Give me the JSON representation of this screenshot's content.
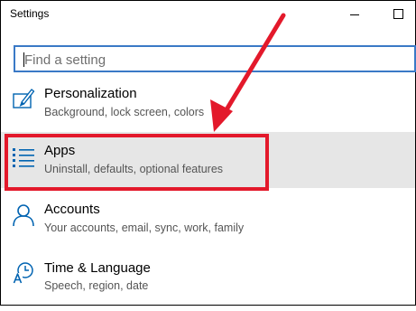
{
  "window": {
    "title": "Settings",
    "controls": {
      "minimize": "minimize",
      "maximize": "maximize"
    }
  },
  "search": {
    "placeholder": "Find a setting",
    "value": ""
  },
  "categories": [
    {
      "name": "Personalization",
      "description": "Background, lock screen, colors",
      "icon": "personalization-icon"
    },
    {
      "name": "Apps",
      "description": "Uninstall, defaults, optional features",
      "icon": "apps-icon",
      "selected": true
    },
    {
      "name": "Accounts",
      "description": "Your accounts, email, sync, work, family",
      "icon": "person-icon"
    },
    {
      "name": "Time & Language",
      "description": "Speech, region, date",
      "icon": "time-language-icon"
    }
  ],
  "annotation": {
    "color": "#e3192b",
    "highlight_target": "Apps",
    "arrow": "pointing at Apps"
  },
  "colors": {
    "accent": "#0063b1",
    "search_border": "#3a79c6",
    "selected_bg": "#e6e6e6"
  }
}
